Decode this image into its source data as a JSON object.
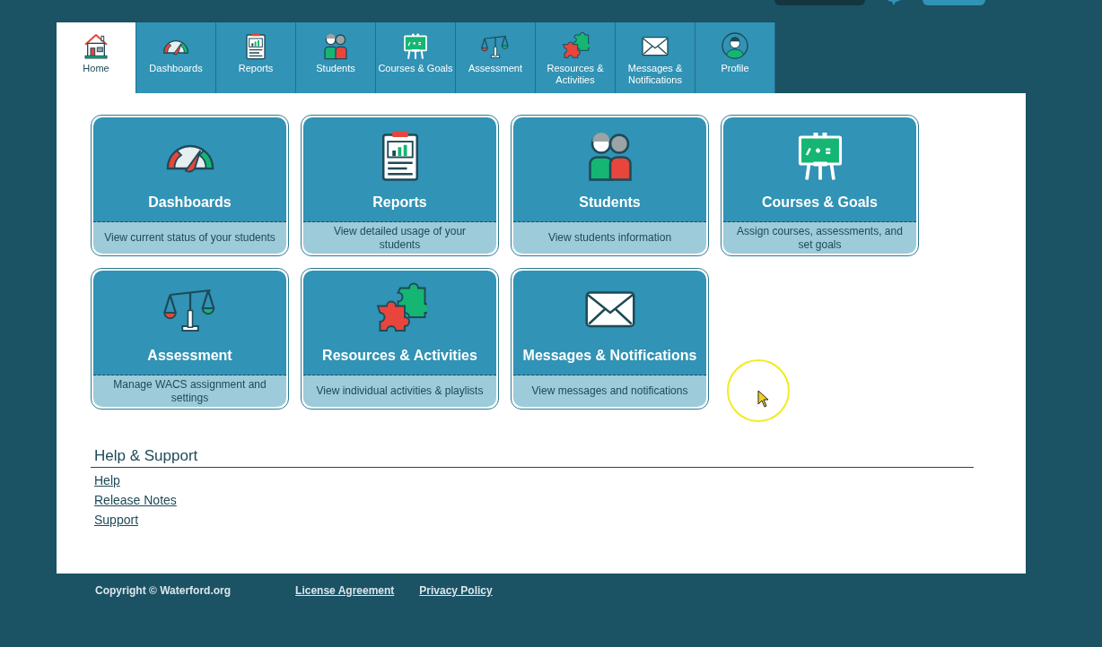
{
  "tabs": [
    {
      "label": "Home",
      "kind": "home",
      "selected": true
    },
    {
      "label": "Dashboards",
      "kind": "gauge",
      "selected": false
    },
    {
      "label": "Reports",
      "kind": "report",
      "selected": false
    },
    {
      "label": "Students",
      "kind": "students",
      "selected": false
    },
    {
      "label": "Courses & Goals",
      "kind": "board",
      "selected": false
    },
    {
      "label": "Assessment",
      "kind": "scale",
      "selected": false
    },
    {
      "label": "Resources & Activities",
      "kind": "puzzle",
      "selected": false
    },
    {
      "label": "Messages & Notifications",
      "kind": "mail",
      "selected": false
    },
    {
      "label": "Profile",
      "kind": "profile",
      "selected": false
    }
  ],
  "cards": [
    {
      "title": "Dashboards",
      "kind": "gauge",
      "description": "View current status of your students"
    },
    {
      "title": "Reports",
      "kind": "report",
      "description": "View detailed usage of your students"
    },
    {
      "title": "Students",
      "kind": "students",
      "description": "View students information"
    },
    {
      "title": "Courses & Goals",
      "kind": "board",
      "description": "Assign courses, assessments, and set goals"
    },
    {
      "title": "Assessment",
      "kind": "scale",
      "description": "Manage WACS assignment and settings"
    },
    {
      "title": "Resources & Activities",
      "kind": "puzzle",
      "description": "View individual activities & playlists"
    },
    {
      "title": "Messages & Notifications",
      "kind": "mail",
      "description": "View messages and notifications"
    }
  ],
  "help": {
    "heading": "Help & Support",
    "links": [
      "Help",
      "Release Notes",
      "Support"
    ]
  },
  "footer": {
    "copyright": "Copyright © Waterford.org",
    "links": [
      "License Agreement",
      "Privacy Policy"
    ]
  }
}
